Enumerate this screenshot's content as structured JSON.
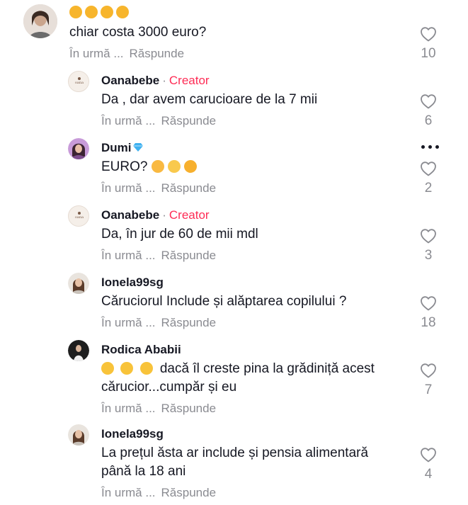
{
  "comments": [
    {
      "emoji_badges": [
        "hug-emoji",
        "hug-emoji",
        "hug-emoji",
        "hug-emoji"
      ],
      "text": "chiar costa 3000 euro?",
      "time": "În urmă ...",
      "reply": "Răspunde",
      "likes": "10"
    },
    {
      "user": "Oanabebe",
      "separator": "·",
      "badge": "Creator",
      "text": "Da , dar avem carucioare de la 7 mii",
      "time": "În urmă ...",
      "reply": "Răspunde",
      "likes": "6"
    },
    {
      "user": "Dumi",
      "text": "EURO?",
      "text_emojis": [
        "face-with-hand-over-mouth",
        "face-with-rolling-eyes",
        "rolling-on-floor-laughing"
      ],
      "time": "În urmă ...",
      "reply": "Răspunde",
      "likes": "2"
    },
    {
      "user": "Oanabebe",
      "separator": "·",
      "badge": "Creator",
      "text": "Da, în jur de 60 de mii mdl",
      "time": "În urmă ...",
      "reply": "Răspunde",
      "likes": "3"
    },
    {
      "user": "Ionela99sg",
      "text": "Căruciorul Include și alăptarea copilului ?",
      "time": "În urmă ...",
      "reply": "Răspunde",
      "likes": "18"
    },
    {
      "user": "Rodica Ababii",
      "text_line1": "dacă îl creste pina la grădiniță acest",
      "text_line2": "cărucior...cumpăr și eu",
      "text_emojis": [
        "grinning-face",
        "grinning-face",
        "grinning-face"
      ],
      "time": "În urmă ...",
      "reply": "Răspunde",
      "likes": "7"
    },
    {
      "user": "Ionela99sg",
      "text_line1": "La prețul ăsta ar include și pensia alimentară",
      "text_line2": "până la 18 ani",
      "time": "În urmă ...",
      "reply": "Răspunde",
      "likes": "4"
    }
  ],
  "colors": {
    "text": "#161823",
    "muted": "#8a8b91",
    "creator": "#fe2c55"
  }
}
